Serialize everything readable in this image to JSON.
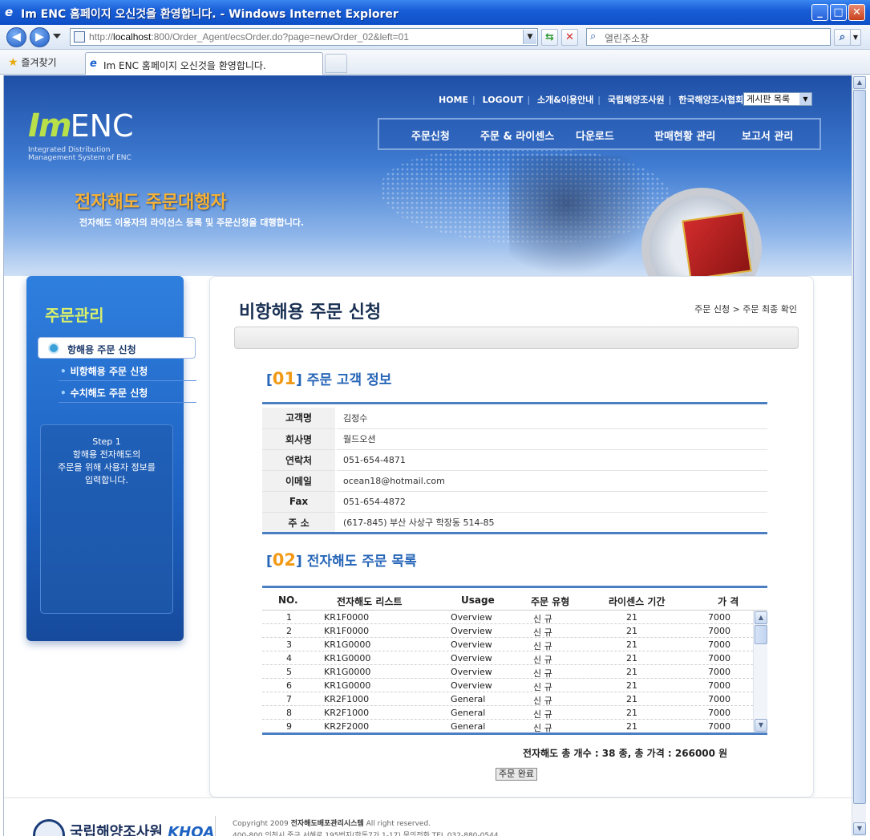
{
  "browser": {
    "window_title": "Im ENC 홈페이지 오신것을 환영합니다. - Windows Internet Explorer",
    "url_prefix": "http://",
    "url_host": "localhost",
    "url_rest": ":800/Order_Agent/ecsOrder.do?page=newOrder_02&left=01",
    "search_placeholder": "열린주소창",
    "favorites_label": "즐겨찾기",
    "tab_title": "Im ENC 홈페이지 오신것을 환영합니다."
  },
  "header": {
    "top_links": [
      "HOME",
      "LOGOUT",
      "소개&이용안내",
      "국립해양조사원",
      "한국해양조사협회"
    ],
    "board_select": "게시판 목록",
    "logo_im": "Im",
    "logo_enc": "ENC",
    "logo_sub1": "Integrated Distribution",
    "logo_sub2": "Management System of ENC",
    "main_nav": [
      "주문신청",
      "주문 & 라이센스",
      "다운로드",
      "판매현황 관리",
      "보고서 관리"
    ],
    "slogan": "전자해도 주문대행자",
    "slogan_sub": "전자해도 이용자의 라이선스 등록 및 주문신청을 대행합니다."
  },
  "sidebar": {
    "title": "주문관리",
    "items": [
      "항해용 주문 신청",
      "비항해용 주문 신청",
      "수치해도 주문 신청"
    ],
    "step_title": "Step 1",
    "step_line1": "항해용 전자해도의",
    "step_line2": "주문을 위해 사용자 정보를",
    "step_line3": "입력합니다."
  },
  "main": {
    "page_title": "비항해용 주문 신청",
    "breadcrumb": "주문 신청 > 주문 최종 확인",
    "section1": {
      "num": "01",
      "title": "주문 고객 정보"
    },
    "customer": [
      {
        "label": "고객명",
        "value": "김정수"
      },
      {
        "label": "회사명",
        "value": "월드오션"
      },
      {
        "label": "연락처",
        "value": "051-654-4871"
      },
      {
        "label": "이메일",
        "value": "ocean18@hotmail.com"
      },
      {
        "label": "Fax",
        "value": "051-654-4872"
      },
      {
        "label": "주 소",
        "value": "(617-845) 부산 사상구 학장동 514-85"
      }
    ],
    "section2": {
      "num": "02",
      "title": "전자해도 주문 목록"
    },
    "order_columns": [
      "NO.",
      "전자해도 리스트",
      "Usage",
      "주문 유형",
      "라이센스 기간",
      "가 격"
    ],
    "orders": [
      [
        "1",
        "KR1F0000",
        "Overview",
        "신 규",
        "21",
        "7000"
      ],
      [
        "2",
        "KR1F0000",
        "Overview",
        "신 규",
        "21",
        "7000"
      ],
      [
        "3",
        "KR1G0000",
        "Overview",
        "신 규",
        "21",
        "7000"
      ],
      [
        "4",
        "KR1G0000",
        "Overview",
        "신 규",
        "21",
        "7000"
      ],
      [
        "5",
        "KR1G0000",
        "Overview",
        "신 규",
        "21",
        "7000"
      ],
      [
        "6",
        "KR1G0000",
        "Overview",
        "신 규",
        "21",
        "7000"
      ],
      [
        "7",
        "KR2F1000",
        "General",
        "신 규",
        "21",
        "7000"
      ],
      [
        "8",
        "KR2F1000",
        "General",
        "신 규",
        "21",
        "7000"
      ],
      [
        "9",
        "KR2F2000",
        "General",
        "신 규",
        "21",
        "7000"
      ]
    ],
    "total_text": "전자해도 총 개수 : 38 종, 총 가격 : 266000 원",
    "done_button": "주문 완료"
  },
  "footer": {
    "logo_text": "국립해양조사원",
    "logo_abbr": "KHOA",
    "copyright_prefix": "Copyright  2009",
    "copyright_name": "전자해도배포관리시스템",
    "copyright_suffix": "All right reserved.",
    "address": "400-800 인천시 중구 서해로 195번지(항동7가 1-17)  문의전화 TEL 032-880-0544"
  }
}
